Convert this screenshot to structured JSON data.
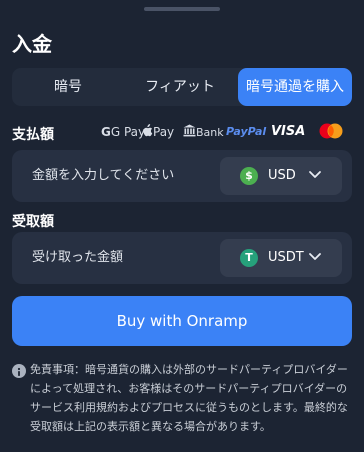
{
  "header": {
    "title": "入金"
  },
  "tabs": [
    {
      "label": "暗号"
    },
    {
      "label": "フィアット"
    },
    {
      "label": "暗号通過を購入",
      "active": true
    }
  ],
  "payment": {
    "label": "支払額",
    "methods": [
      {
        "name": "G Pay",
        "icon": "google-pay-icon"
      },
      {
        "name": "Pay",
        "icon": "apple-pay-icon"
      },
      {
        "name": "Bank",
        "icon": "bank-icon"
      },
      {
        "name": "PayPal",
        "icon": "paypal-icon"
      },
      {
        "name": "VISA",
        "icon": "visa-icon"
      },
      {
        "name": "",
        "icon": "mastercard-icon"
      }
    ],
    "placeholder": "金額を入力してください",
    "currency": {
      "code": "USD",
      "icon": "dollar-coin-icon",
      "color": "#4caf50"
    }
  },
  "receive": {
    "label": "受取額",
    "placeholder": "受け取った金額",
    "currency": {
      "code": "USDT",
      "icon": "tether-coin-icon",
      "color": "#26a17b"
    }
  },
  "cta": {
    "label": "Buy with Onramp",
    "color": "#3b82f6"
  },
  "disclaimer": {
    "icon": "info-icon",
    "text": "免責事項：暗号通貨の購入は外部のサードパーティプロバイダーによって処理され、お客様はそのサードパーティプロバイダーのサービス利用規約およびプロセスに従うものとします。最終的な受取額は上記の表示額と異なる場合があります。"
  }
}
